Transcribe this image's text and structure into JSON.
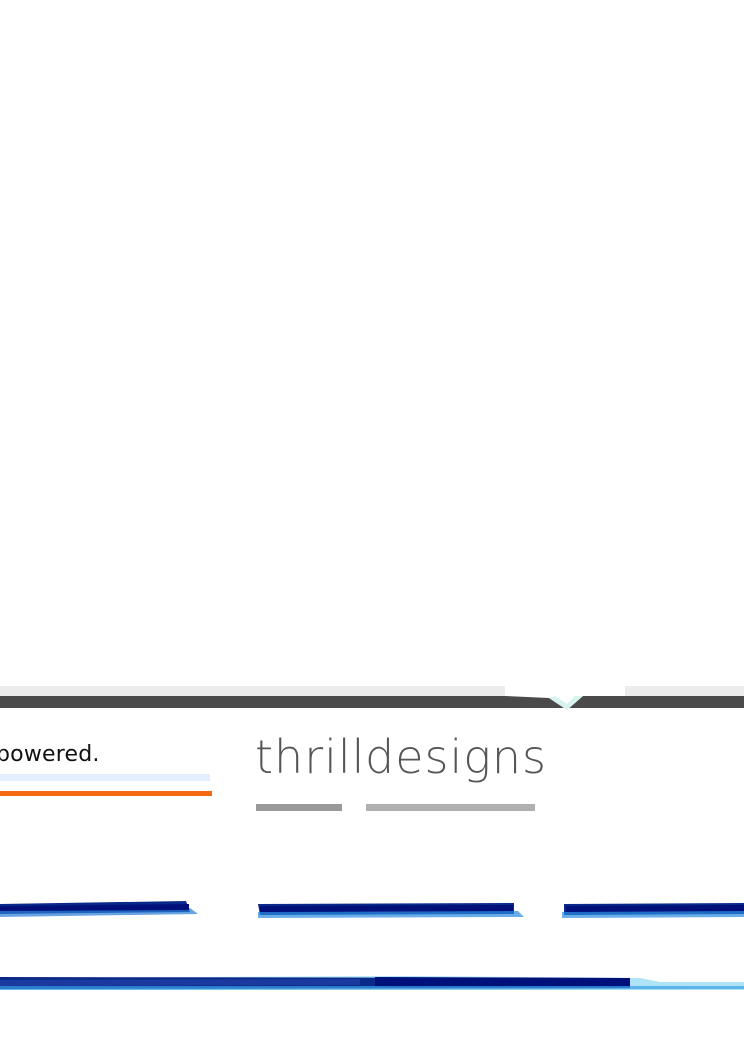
{
  "left_text": "powered.",
  "brand": {
    "word1": "thrill",
    "word2": "designs"
  },
  "colors": {
    "band_dark": "#4a4a4a",
    "band_light": "#ececec",
    "accent_orange": "#f36a10",
    "accent_light_blue": "#e3efff",
    "brush_blue": "#0a2a8a",
    "brand_text": "#555555"
  }
}
